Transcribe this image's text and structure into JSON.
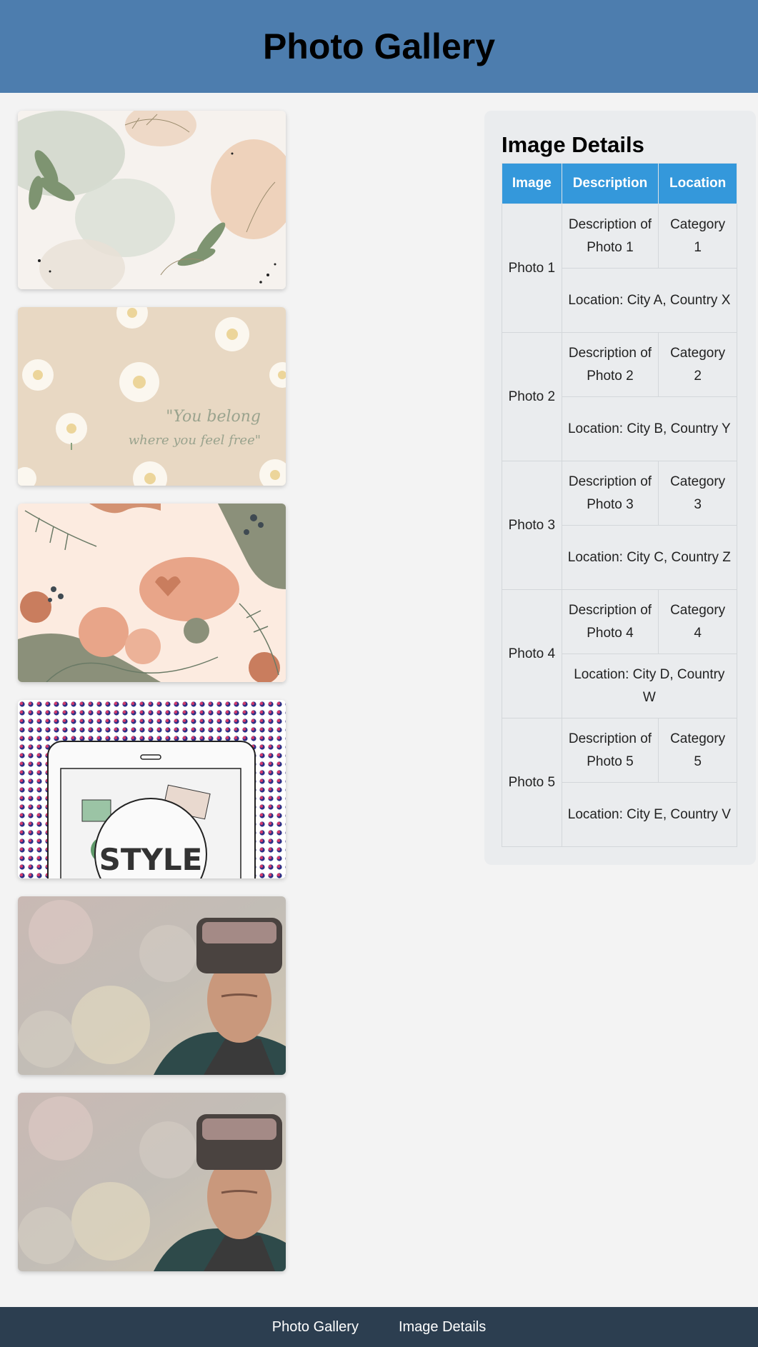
{
  "header": {
    "title": "Photo Gallery"
  },
  "gallery": {
    "photos": [
      {
        "alt": "Floral watercolor",
        "theme": "leaves-sage"
      },
      {
        "alt": "Daisy background",
        "theme": "daisies",
        "caption_line1": "\"You belong",
        "caption_line2": "where you feel free\""
      },
      {
        "alt": "Boho leaves",
        "theme": "boho"
      },
      {
        "alt": "Style tablet",
        "theme": "style",
        "badge": "STYLE"
      },
      {
        "alt": "VR headset man",
        "theme": "vr"
      },
      {
        "alt": "VR headset man",
        "theme": "vr"
      }
    ]
  },
  "details": {
    "title": "Image Details",
    "columns": [
      "Image",
      "Description",
      "Location"
    ],
    "rows": [
      {
        "image": "Photo 1",
        "description": "Description of Photo 1",
        "category": "Category 1",
        "location": "Location: City A, Country X"
      },
      {
        "image": "Photo 2",
        "description": "Description of Photo 2",
        "category": "Category 2",
        "location": "Location: City B, Country Y"
      },
      {
        "image": "Photo 3",
        "description": "Description of Photo 3",
        "category": "Category 3",
        "location": "Location: City C, Country Z"
      },
      {
        "image": "Photo 4",
        "description": "Description of Photo 4",
        "category": "Category 4",
        "location": "Location: City D, Country W"
      },
      {
        "image": "Photo 5",
        "description": "Description of Photo 5",
        "category": "Category 5",
        "location": "Location: City E, Country V"
      }
    ]
  },
  "footer": {
    "links": [
      "Photo Gallery",
      "Image Details"
    ]
  },
  "colors": {
    "header_bg": "#4d7dae",
    "table_header_bg": "#3498db",
    "footer_bg": "#2c3e50",
    "page_bg": "#f3f3f3"
  }
}
